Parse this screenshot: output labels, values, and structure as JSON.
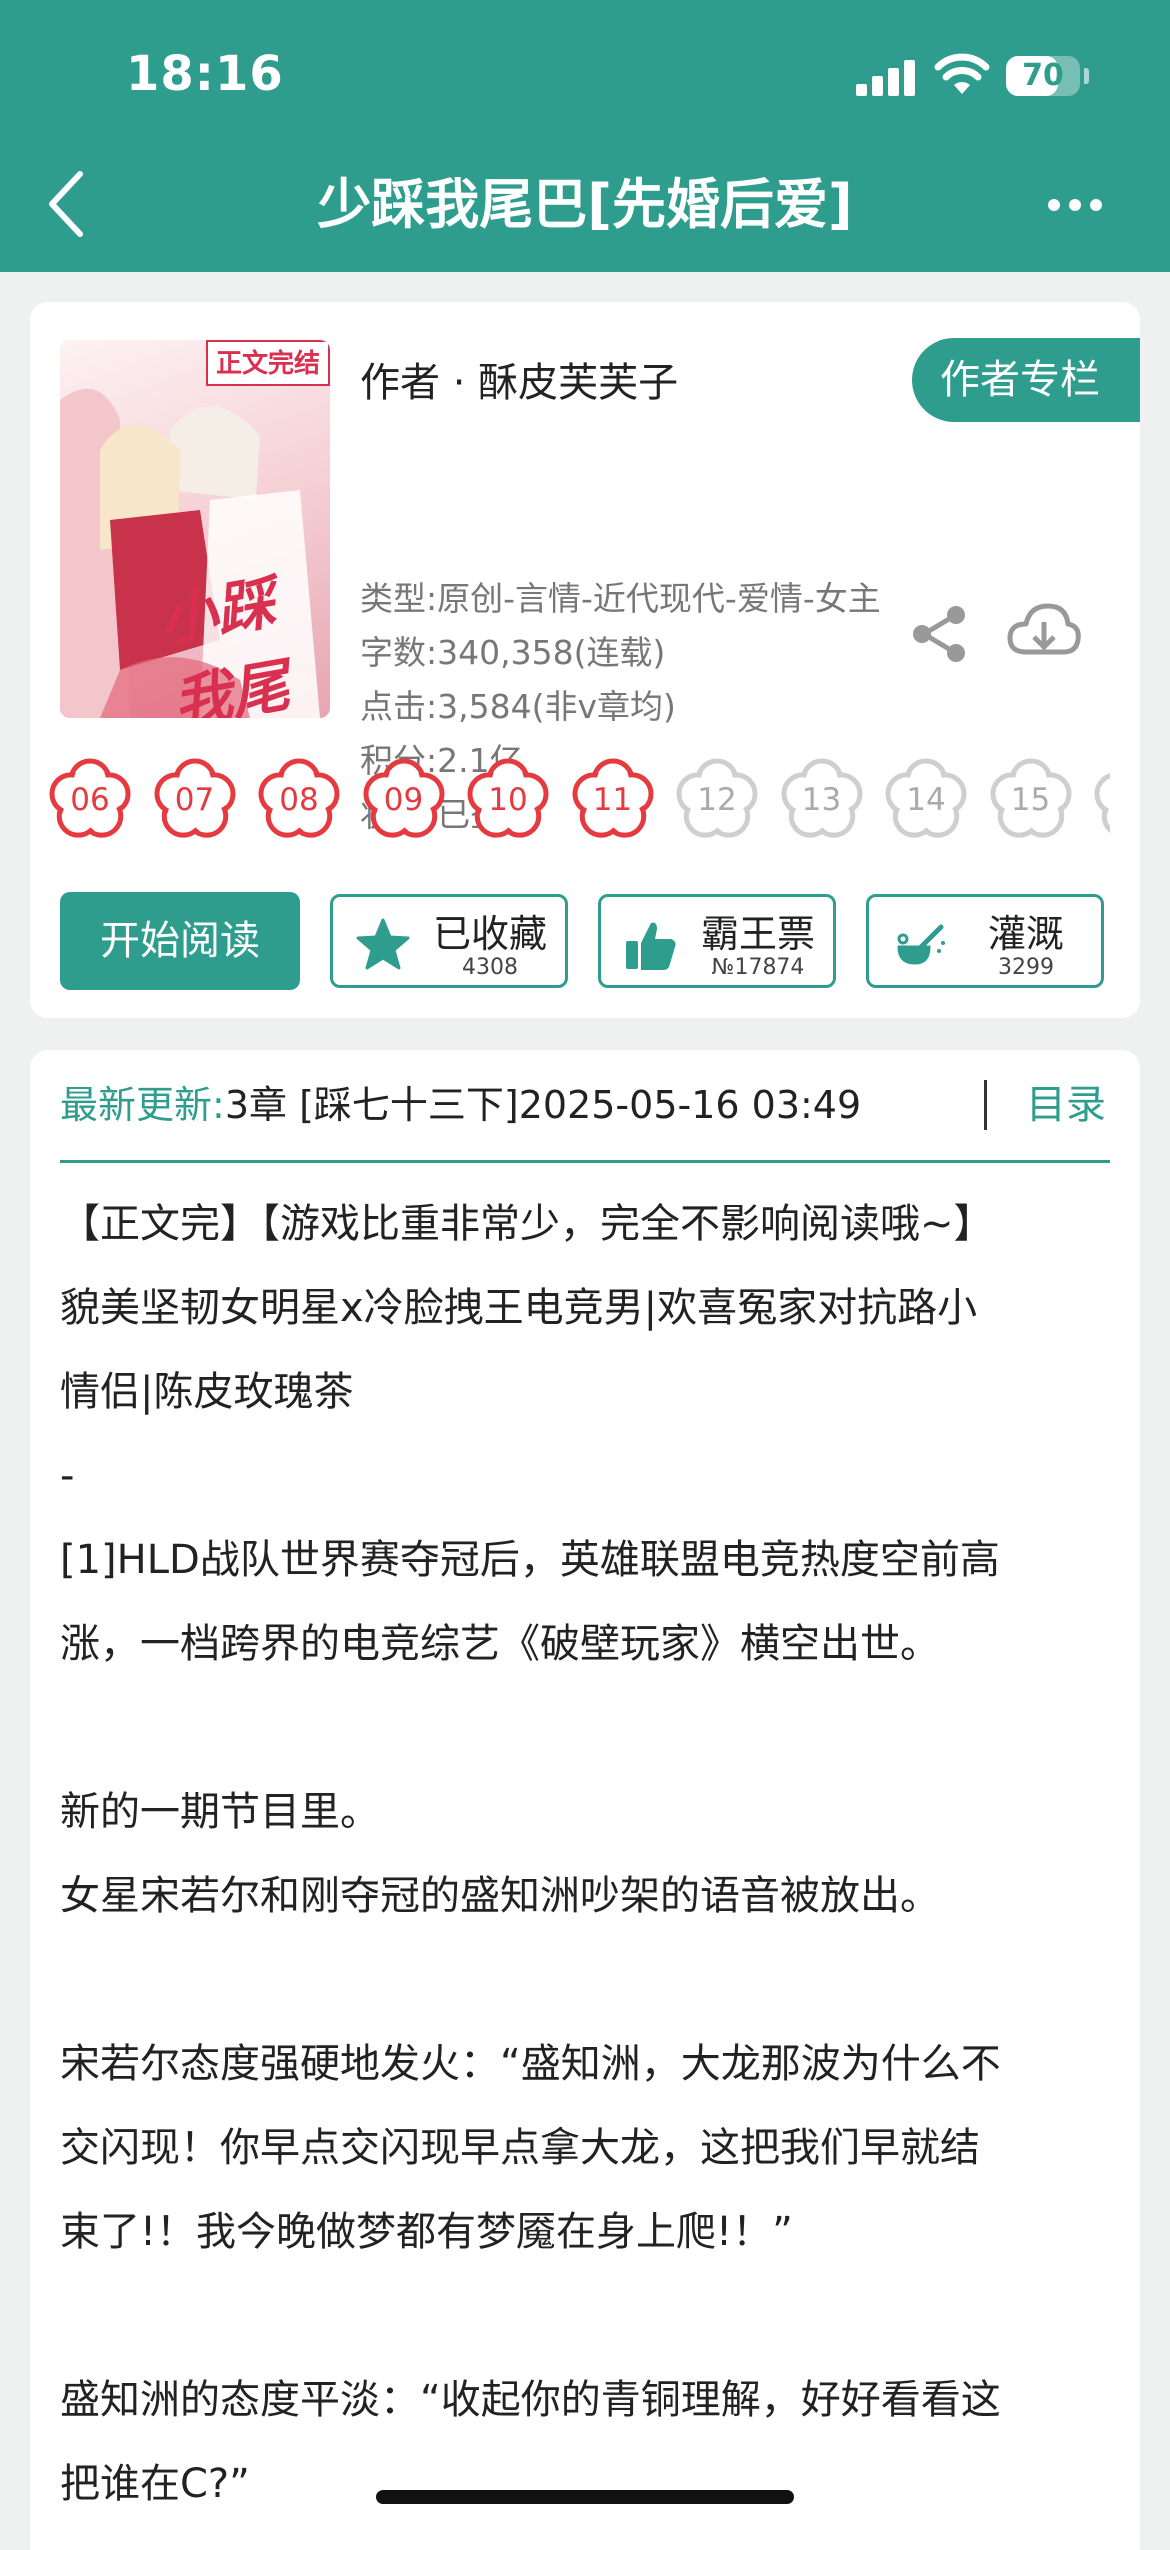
{
  "status_bar": {
    "time": "18:16",
    "battery": "70",
    "battery_level": 0.7
  },
  "header": {
    "title": "少踩我尾巴[先婚后爱]"
  },
  "book": {
    "cover_tag": "正文完结",
    "cover_script": "小踩我尾巴",
    "author": "作者 · 酥皮芙芙子",
    "author_column_button": "作者专栏",
    "meta": [
      "类型:原创-言情-近代现代-爱情-女主",
      "字数:340,358(连载)",
      "点击:3,584(非v章均)",
      "积分:2.1亿",
      "状态:已签约"
    ],
    "flowers": [
      {
        "n": "06",
        "active": true
      },
      {
        "n": "07",
        "active": true
      },
      {
        "n": "08",
        "active": true
      },
      {
        "n": "09",
        "active": true
      },
      {
        "n": "10",
        "active": true
      },
      {
        "n": "11",
        "active": true
      },
      {
        "n": "12",
        "active": false
      },
      {
        "n": "13",
        "active": false
      },
      {
        "n": "14",
        "active": false
      },
      {
        "n": "15",
        "active": false
      },
      {
        "n": "",
        "active": false
      }
    ],
    "colors": {
      "accent": "#2e9d8e",
      "flower_active": "#e53a3f",
      "flower_inactive": "#cfcfcf"
    }
  },
  "actions": {
    "read": "开始阅读",
    "collect": {
      "label": "已收藏",
      "count": "4308"
    },
    "vote": {
      "label": "霸王票",
      "count": "№17874"
    },
    "water": {
      "label": "灌溉",
      "count": "3299"
    }
  },
  "latest": {
    "label": "最新更新:",
    "value": "3章 [踩七十三下]2025-05-16 03:49",
    "toc": "目录"
  },
  "description": [
    "【正文完】【游戏比重非常少，完全不影响阅读哦~】",
    "貌美坚韧女明星x冷脸拽王电竞男|欢喜冤家对抗路小",
    "情侣|陈皮玫瑰茶",
    "-",
    "[1]HLD战队世界赛夺冠后，英雄联盟电竞热度空前高",
    "涨，一档跨界的电竞综艺《破壁玩家》横空出世。",
    "",
    "新的一期节目里。",
    "女星宋若尔和刚夺冠的盛知洲吵架的语音被放出。",
    "",
    "宋若尔态度强硬地发火：“盛知洲，大龙那波为什么不",
    "交闪现！你早点交闪现早点拿大龙，这把我们早就结",
    "束了!！我今晚做梦都有梦魇在身上爬!！”",
    "",
    "盛知洲的态度平淡：“收起你的青铜理解，好好看看这",
    "把谁在C?”"
  ]
}
